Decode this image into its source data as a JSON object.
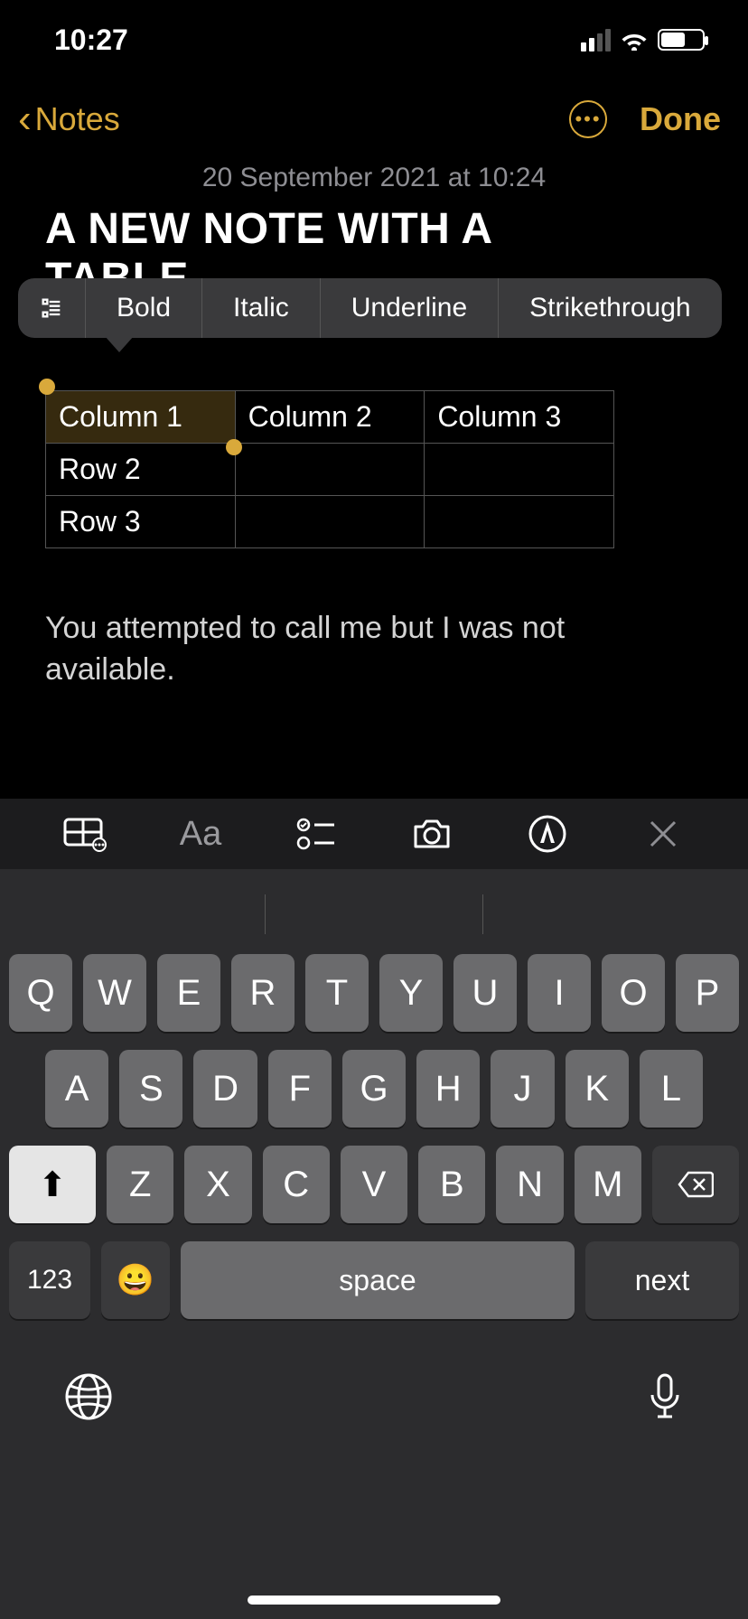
{
  "status": {
    "time": "10:27"
  },
  "nav": {
    "back_label": "Notes",
    "done_label": "Done"
  },
  "note": {
    "timestamp": "20 September 2021 at 10:24",
    "title_line1": "A NEW NOTE WITH A",
    "title_line2": "TABLE",
    "body_text": "You attempted to call me but I was not available."
  },
  "context_menu": {
    "bold": "Bold",
    "italic": "Italic",
    "underline": "Underline",
    "strike": "Strikethrough"
  },
  "table": {
    "r1c1": "Column 1",
    "r1c2": "Column 2",
    "r1c3": "Column 3",
    "r2c1": "Row 2",
    "r2c2": "",
    "r2c3": "",
    "r3c1": "Row 3",
    "r3c2": "",
    "r3c3": ""
  },
  "fmt_toolbar": {
    "aa": "Aa"
  },
  "keyboard": {
    "row1": [
      "Q",
      "W",
      "E",
      "R",
      "T",
      "Y",
      "U",
      "I",
      "O",
      "P"
    ],
    "row2": [
      "A",
      "S",
      "D",
      "F",
      "G",
      "H",
      "J",
      "K",
      "L"
    ],
    "row3": [
      "Z",
      "X",
      "C",
      "V",
      "B",
      "N",
      "M"
    ],
    "numbers": "123",
    "space": "space",
    "next": "next"
  }
}
